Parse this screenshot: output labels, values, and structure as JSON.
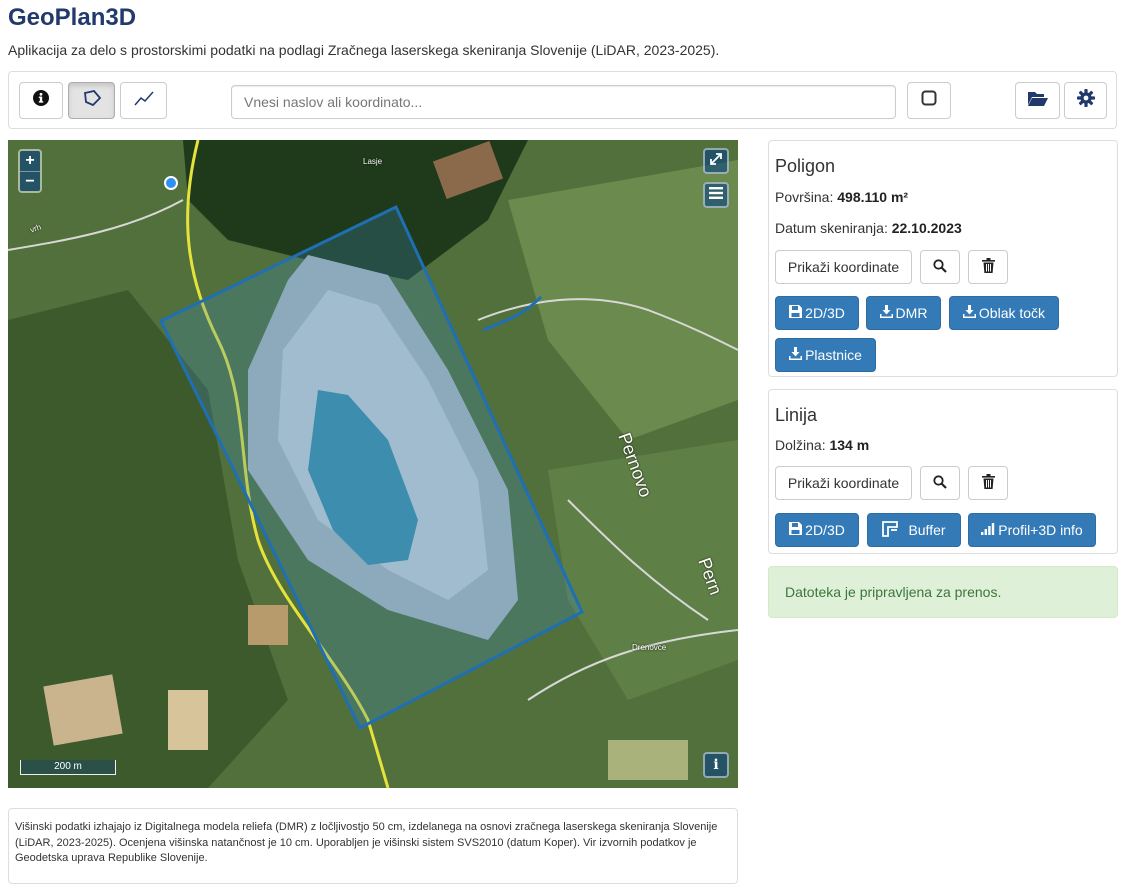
{
  "app": {
    "title": "GeoPlan3D",
    "subtitle": "Aplikacija za delo s prostorskimi podatki na podlagi Zračnega laserskega skeniranja Slovenije (LiDAR, 2023-2025)."
  },
  "toolbar": {
    "buttons": [
      {
        "name": "info-button",
        "icon": "info-circle-icon",
        "active": false
      },
      {
        "name": "polygon-tool-button",
        "icon": "polygon-icon",
        "active": true
      },
      {
        "name": "line-tool-button",
        "icon": "line-chart-icon",
        "active": false
      }
    ],
    "search_placeholder": "Vnesi naslov ali koordinato...",
    "search_value": "",
    "right_buttons": [
      {
        "name": "stop-button",
        "icon": "stop-icon"
      },
      {
        "name": "open-folder-button",
        "icon": "folder-open-icon"
      },
      {
        "name": "settings-button",
        "icon": "gear-icon"
      }
    ]
  },
  "map": {
    "zoom_in": "+",
    "zoom_out": "−",
    "scale_label": "200 m",
    "place_labels": [
      "Lasje",
      "Pernovo",
      "Pern",
      "Drenovce",
      "vrh"
    ],
    "controls": [
      "fullscreen-icon",
      "layers-icon",
      "info-icon"
    ],
    "colors": {
      "polygon": "#1f6fb5",
      "line": "#1f6fb5",
      "road": "#e6e23c",
      "location_dot": "#2f8ff2"
    }
  },
  "polygon_panel": {
    "title": "Poligon",
    "area_label": "Površina:",
    "area_value": "498.110 m²",
    "scan_date_label": "Datum skeniranja:",
    "scan_date_value": "22.10.2023",
    "show_coords_label": "Prikaži koordinate",
    "downloads": [
      "2D/3D",
      "DMR",
      "Oblak točk",
      "Plastnice"
    ]
  },
  "line_panel": {
    "title": "Linija",
    "length_label": "Dolžina:",
    "length_value": "134 m",
    "show_coords_label": "Prikaži koordinate",
    "actions": [
      "2D/3D",
      "Buffer",
      "Profil+3D info"
    ]
  },
  "alert": {
    "text": "Datoteka je pripravljena za prenos.",
    "color": "#dff0d8"
  },
  "footnote": {
    "text": "Višinski podatki izhajajo iz Digitalnega modela reliefa (DMR) z ločljivostjo 50 cm, izdelanega na osnovi zračnega laserskega skeniranja Slovenije (LiDAR, 2023-2025). Ocenjena višinska natančnost je 10 cm. Uporabljen je višinski sistem SVS2010 (datum Koper). Vir izvornih podatkov je Geodetska uprava Republike Slovenije."
  },
  "colors": {
    "brand_title": "#223a6b",
    "primary": "#337ab7"
  }
}
